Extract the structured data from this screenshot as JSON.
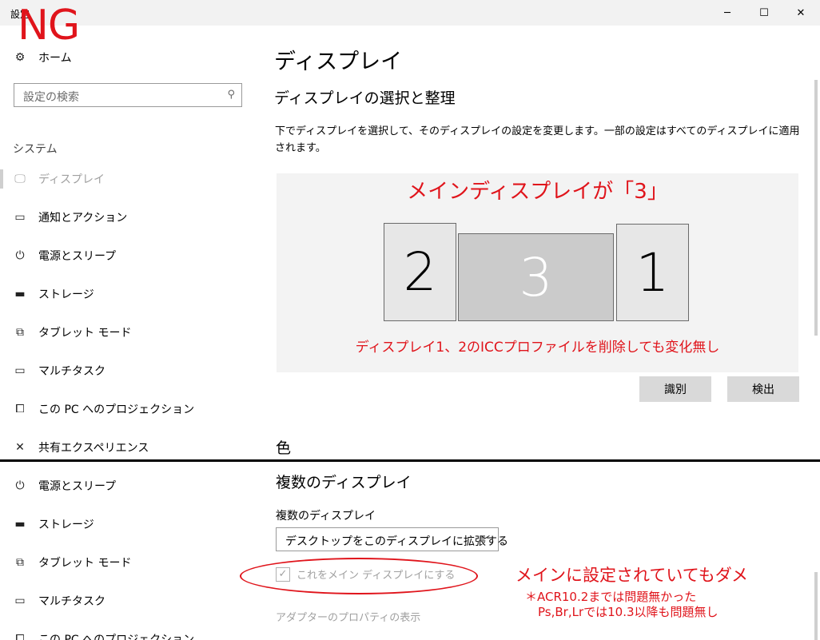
{
  "window": {
    "title": "設定",
    "minimize_glyph": "─",
    "maximize_glyph": "☐",
    "close_glyph": "✕"
  },
  "overlay": {
    "ng_label": "NG"
  },
  "sidebar": {
    "home": {
      "label": "ホーム",
      "icon": "gear-icon"
    },
    "search": {
      "placeholder": "設定の検索"
    },
    "section": "システム",
    "items": [
      {
        "label": "ディスプレイ",
        "icon": "monitor-icon",
        "active": true
      },
      {
        "label": "通知とアクション",
        "icon": "notification-icon"
      },
      {
        "label": "電源とスリープ",
        "icon": "power-icon"
      },
      {
        "label": "ストレージ",
        "icon": "storage-icon"
      },
      {
        "label": "タブレット モード",
        "icon": "tablet-mode-icon"
      },
      {
        "label": "マルチタスク",
        "icon": "multitask-icon"
      },
      {
        "label": "この PC へのプロジェクション",
        "icon": "projection-icon"
      },
      {
        "label": "共有エクスペリエンス",
        "icon": "shared-experience-icon"
      }
    ]
  },
  "main": {
    "title": "ディスプレイ",
    "arrange_heading": "ディスプレイの選択と整理",
    "arrange_desc": "下でディスプレイを選択して、そのディスプレイの設定を変更します。一部の設定はすべてのディスプレイに適用されます。",
    "monitors": {
      "left": "2",
      "center": "3",
      "right": "1"
    },
    "identify_button": "識別",
    "detect_button": "検出",
    "color_heading": "色"
  },
  "annotations": {
    "main_display": "メインディスプレイが「3」",
    "icc_note": "ディスプレイ1、2のICCプロファイルを削除しても変化無し",
    "dame": "メインに設定されていてもダメ",
    "note_line1": "＊ACR10.2までは問題無かった",
    "note_line2": "Ps,Br,Lrでは10.3以降も問題無し"
  },
  "lower": {
    "sidebar": [
      {
        "label": "電源とスリープ",
        "icon": "power-icon"
      },
      {
        "label": "ストレージ",
        "icon": "storage-icon"
      },
      {
        "label": "タブレット モード",
        "icon": "tablet-mode-icon"
      },
      {
        "label": "マルチタスク",
        "icon": "multitask-icon"
      },
      {
        "label": "この PC へのプロジェクション",
        "icon": "projection-icon"
      }
    ],
    "multi_heading": "複数のディスプレイ",
    "multi_label": "複数のディスプレイ",
    "multi_value": "デスクトップをこのディスプレイに拡張する",
    "make_main": "これをメイン ディスプレイにする",
    "make_main_checked": true,
    "adapter_link": "アダプターのプロパティの表示"
  },
  "colors": {
    "annotation_red": "#e0141b",
    "disabled_gray": "#a0a0a0",
    "button_gray": "#d9d9d9"
  }
}
